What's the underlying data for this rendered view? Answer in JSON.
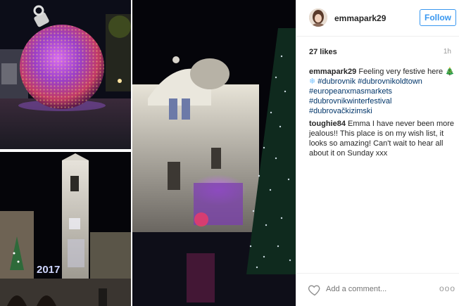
{
  "post": {
    "username": "emmapark29",
    "follow_label": "Follow",
    "likes": "27 likes",
    "time": "1h"
  },
  "caption": {
    "username": "emmapark29",
    "text": "Feeling very festive here",
    "tags": [
      "#dubrovnik",
      "#dubrovnikoldtown",
      "#europeanxmasmarkets",
      "#dubrovnikwinterfestival",
      "#dubrovačkizimski"
    ]
  },
  "comments": [
    {
      "username": "toughie84",
      "text": "Emma I have never been more jealous!! This place is on my wish list, it looks so amazing! Can't wait to hear all about it on Sunday xxx"
    }
  ],
  "footer": {
    "add_comment_placeholder": "Add a comment...",
    "more": "ooo"
  },
  "photo": {
    "year_sign": "2017"
  },
  "icons": {
    "heart": "heart-icon",
    "tree_emoji": "🎄",
    "snowflake": "❄"
  }
}
